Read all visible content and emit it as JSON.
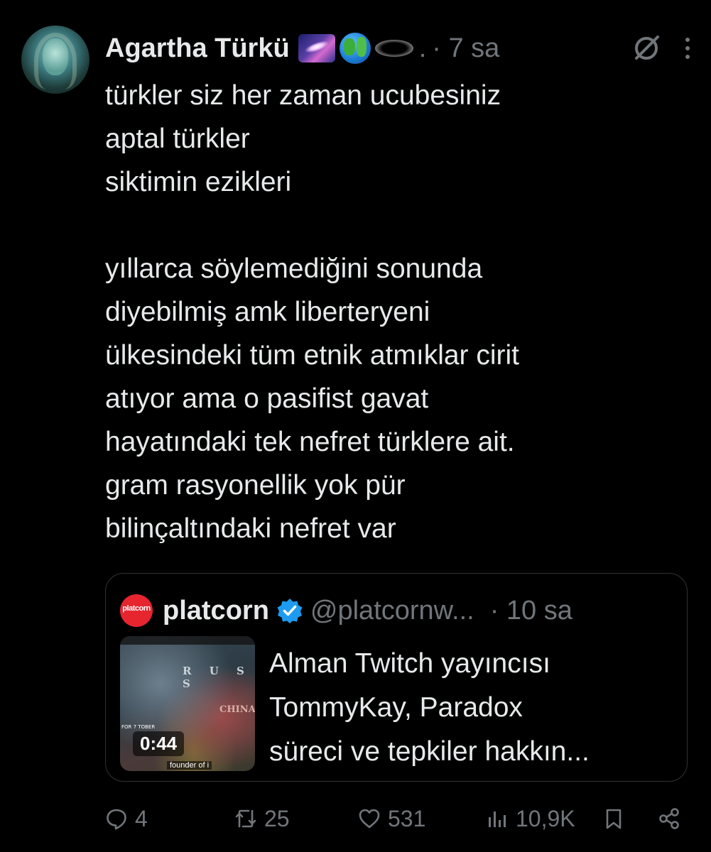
{
  "tweet": {
    "author_name": "Agartha Türkü",
    "author_emojis": [
      "galaxy-emoji",
      "globe-emoji",
      "hole-emoji"
    ],
    "ellipsis": ".",
    "time": "· 7 sa",
    "text_lines": [
      "türkler siz her zaman ucubesiniz",
      "aptal türkler",
      "siktimin ezikleri",
      "",
      "yıllarca söylemediğini sonunda",
      "diyebilmiş amk liberteryeni",
      "ülkesindeki tüm etnik atmıklar cirit",
      "atıyor ama o pasifist gavat",
      "hayatındaki tek nefret türklere ait.",
      "gram rasyonellik yok pür",
      "bilinçaltındaki nefret var"
    ]
  },
  "quote": {
    "logo_text": "platcorn",
    "name": "platcorn",
    "handle": "@platcornw...",
    "time": "· 10 sa",
    "media": {
      "duration": "0:44",
      "map_label_russia": "R U S S",
      "map_label_china": "CHINA",
      "side_text": "FOR 7 TOBER",
      "caption": "founder of i"
    },
    "text_lines": [
      "Alman Twitch yayıncısı",
      "TommyKay, Paradox",
      "süreci ve tepkiler hakkın..."
    ]
  },
  "actions": {
    "replies": "4",
    "reposts": "25",
    "likes": "531",
    "views": "10,9K"
  },
  "colors": {
    "background": "#000000",
    "text": "#e7e9ea",
    "secondary": "#71767b",
    "border": "#2f3336",
    "verified": "#1d9bf0",
    "platcorn_red": "#e6252f"
  }
}
